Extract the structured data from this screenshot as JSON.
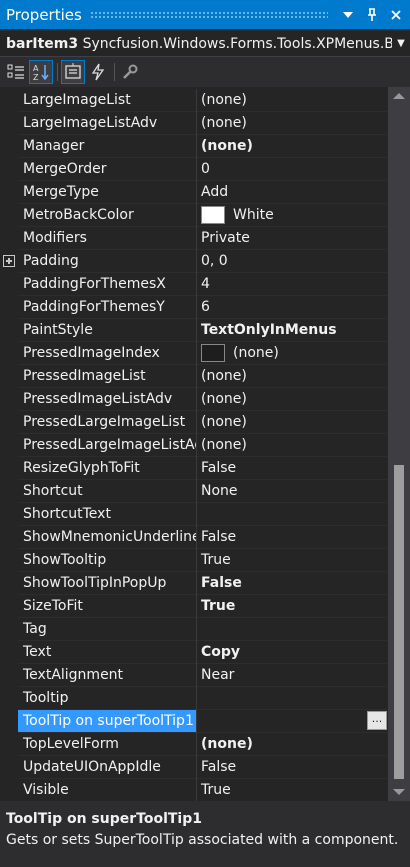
{
  "window": {
    "title": "Properties"
  },
  "selector": {
    "object_name": "barItem3",
    "object_type": "Syncfusion.Windows.Forms.Tools.XPMenus.BarIt"
  },
  "toolbar": {
    "buttons": [
      {
        "name": "categorized-icon",
        "active": false
      },
      {
        "name": "alphabetical-icon",
        "active": true
      },
      {
        "name": "properties-icon",
        "active": true
      },
      {
        "name": "events-icon",
        "active": false
      },
      {
        "name": "property-pages-icon",
        "active": false
      }
    ]
  },
  "grid": {
    "rows": [
      {
        "name": "LargeImageList",
        "value": "(none)"
      },
      {
        "name": "LargeImageListAdv",
        "value": "(none)"
      },
      {
        "name": "Manager",
        "value": "(none)",
        "bold": true
      },
      {
        "name": "MergeOrder",
        "value": "0"
      },
      {
        "name": "MergeType",
        "value": "Add"
      },
      {
        "name": "MetroBackColor",
        "value": "White",
        "swatch": "#ffffff"
      },
      {
        "name": "Modifiers",
        "value": "Private"
      },
      {
        "name": "Padding",
        "value": "0, 0",
        "expandable": true
      },
      {
        "name": "PaddingForThemesX",
        "value": "4"
      },
      {
        "name": "PaddingForThemesY",
        "value": "6"
      },
      {
        "name": "PaintStyle",
        "value": "TextOnlyInMenus",
        "bold": true
      },
      {
        "name": "PressedImageIndex",
        "value": "(none)",
        "swatch": "#1e1e1e"
      },
      {
        "name": "PressedImageList",
        "value": "(none)"
      },
      {
        "name": "PressedImageListAdv",
        "value": "(none)"
      },
      {
        "name": "PressedLargeImageList",
        "value": "(none)"
      },
      {
        "name": "PressedLargeImageListAdv",
        "value": "(none)"
      },
      {
        "name": "ResizeGlyphToFit",
        "value": "False"
      },
      {
        "name": "Shortcut",
        "value": "None"
      },
      {
        "name": "ShortcutText",
        "value": ""
      },
      {
        "name": "ShowMnemonicUnderlines",
        "value": "False"
      },
      {
        "name": "ShowTooltip",
        "value": "True"
      },
      {
        "name": "ShowToolTipInPopUp",
        "value": "False",
        "bold": true
      },
      {
        "name": "SizeToFit",
        "value": "True",
        "bold": true
      },
      {
        "name": "Tag",
        "value": ""
      },
      {
        "name": "Text",
        "value": "Copy",
        "bold": true
      },
      {
        "name": "TextAlignment",
        "value": "Near"
      },
      {
        "name": "Tooltip",
        "value": ""
      },
      {
        "name": "ToolTip on superToolTip1",
        "value": "",
        "selected": true,
        "ellipsis": "..."
      },
      {
        "name": "TopLevelForm",
        "value": "(none)",
        "bold": true
      },
      {
        "name": "UpdateUIOnAppIdle",
        "value": "False"
      },
      {
        "name": "Visible",
        "value": "True"
      }
    ]
  },
  "description": {
    "title": "ToolTip on superToolTip1",
    "text": "Gets or sets SuperToolTip associated with a component."
  },
  "colors": {
    "accent": "#007acc",
    "selection": "#3399ff",
    "background": "#252526"
  }
}
